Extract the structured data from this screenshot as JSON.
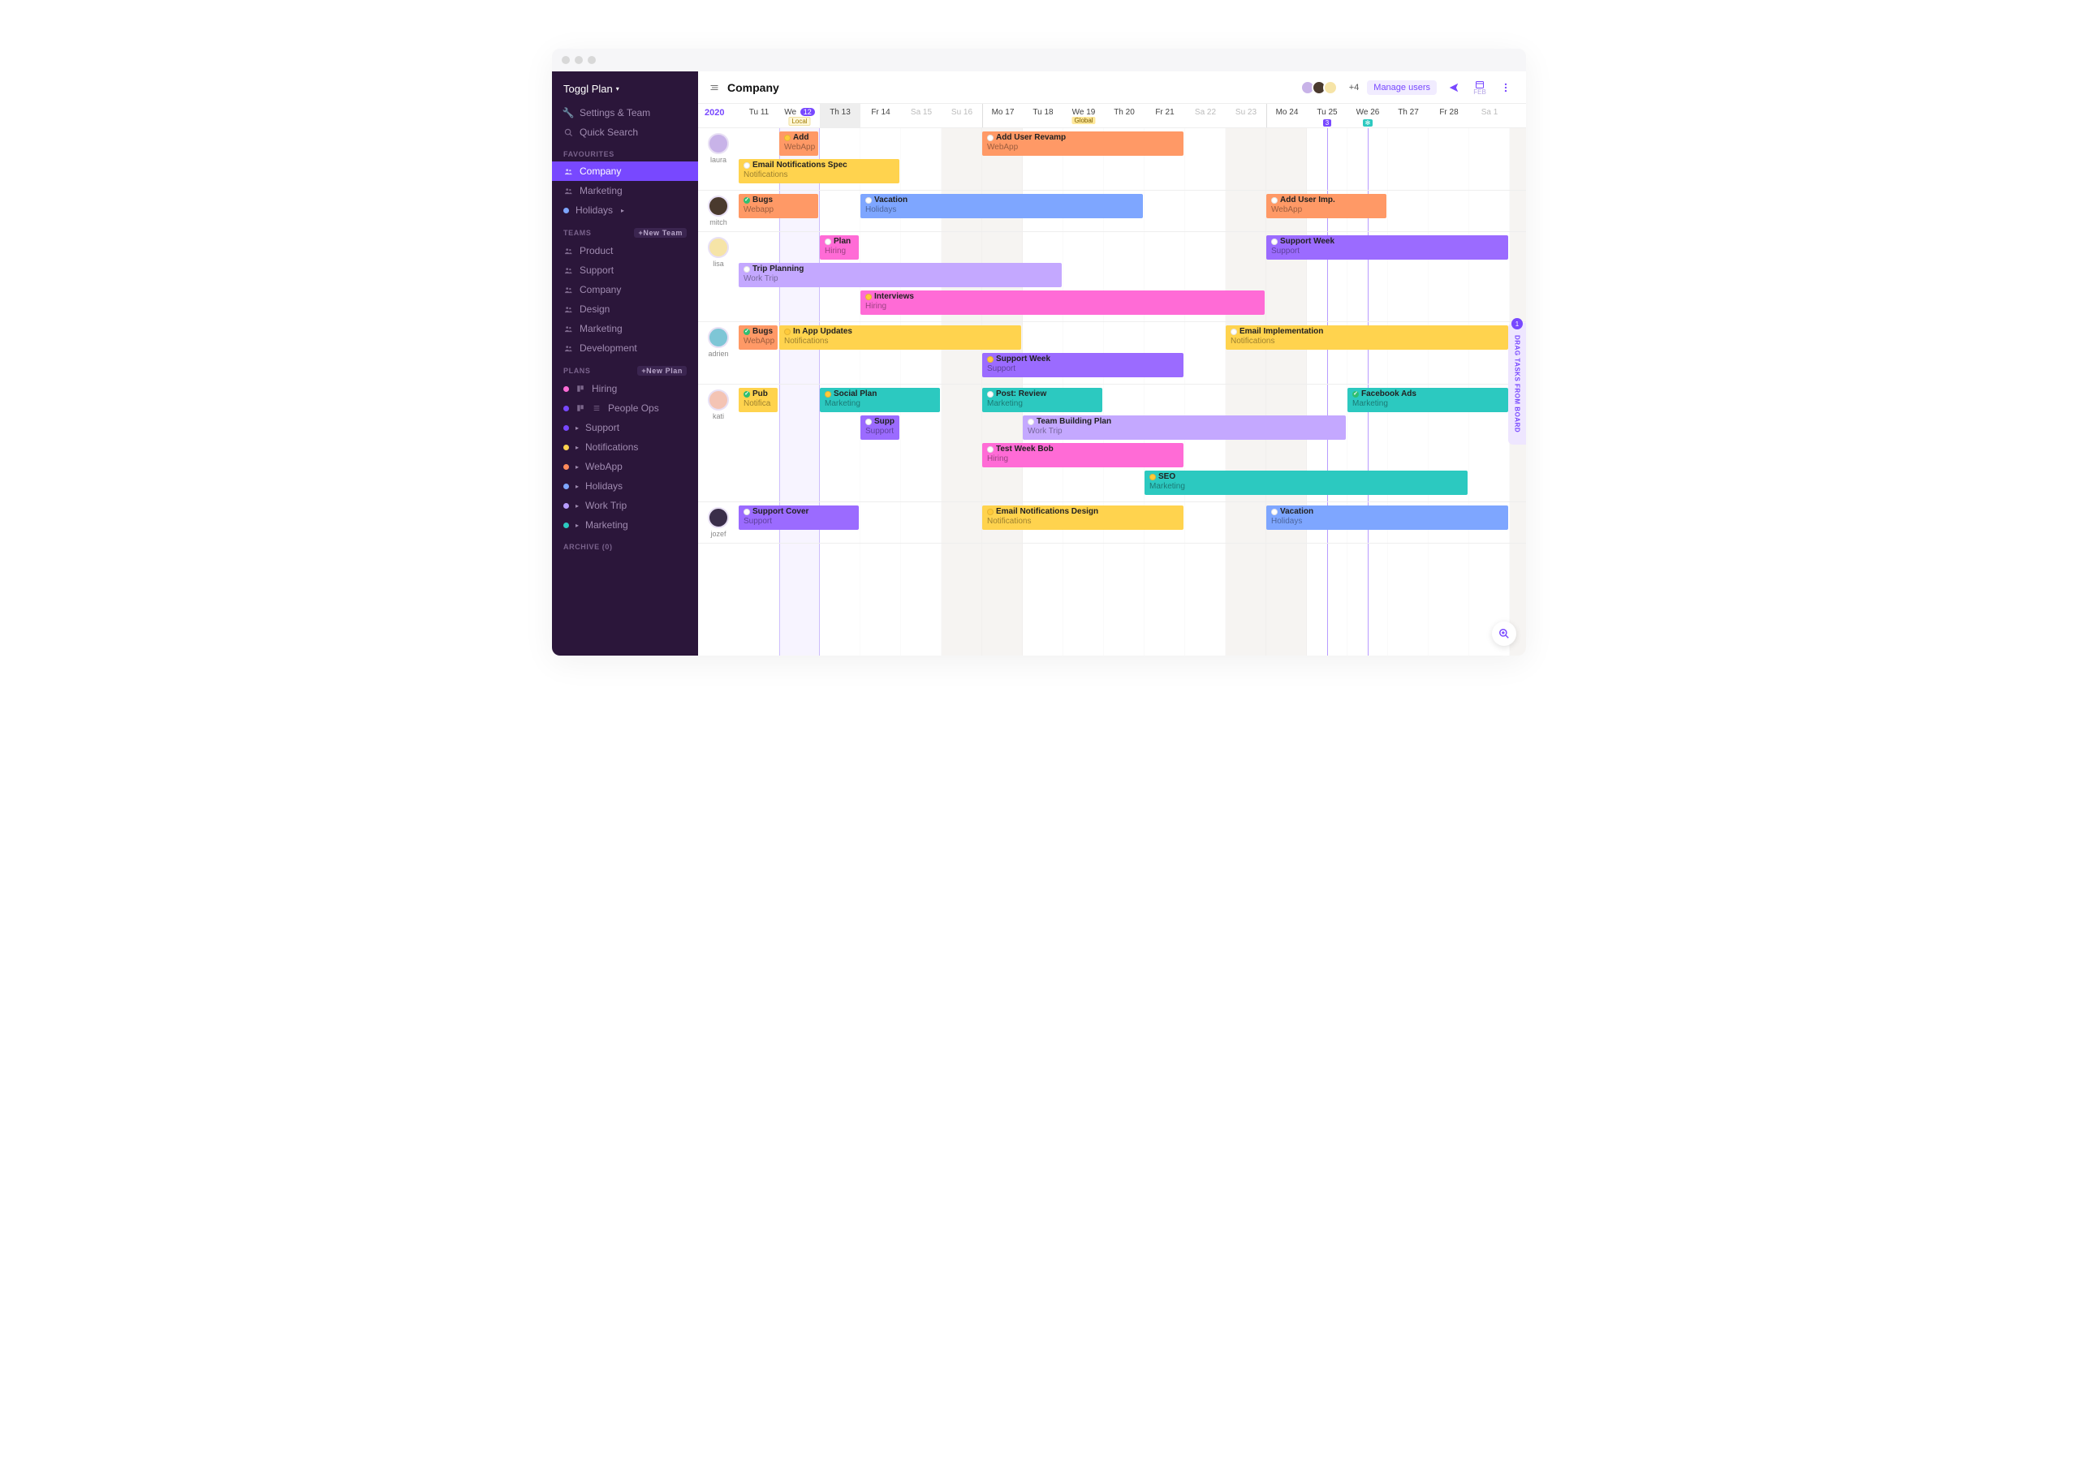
{
  "brand": "Toggl Plan",
  "sidebar": {
    "settings": "Settings & Team",
    "search": "Quick Search",
    "favourites_head": "FAVOURITES",
    "favourites": [
      {
        "label": "Company",
        "type": "team",
        "active": true
      },
      {
        "label": "Marketing",
        "type": "team"
      },
      {
        "label": "Holidays",
        "type": "plan",
        "color": "#7ea6ff",
        "arrow": true
      }
    ],
    "teams_head": "TEAMS",
    "teams_btn": "+New Team",
    "teams": [
      "Product",
      "Support",
      "Company",
      "Design",
      "Marketing",
      "Development"
    ],
    "plans_head": "PLANS",
    "plans_btn": "+New Plan",
    "plans": [
      {
        "label": "Hiring",
        "color": "#ff6bd6",
        "board": true
      },
      {
        "label": "People Ops",
        "color": "#7848ff",
        "board": true,
        "list": true
      },
      {
        "label": "Support",
        "color": "#7848ff",
        "arrow": true
      },
      {
        "label": "Notifications",
        "color": "#ffd34e",
        "arrow": true
      },
      {
        "label": "WebApp",
        "color": "#ff8a5b",
        "arrow": true
      },
      {
        "label": "Holidays",
        "color": "#7ea6ff",
        "arrow": true
      },
      {
        "label": "Work Trip",
        "color": "#b89cff",
        "arrow": true
      },
      {
        "label": "Marketing",
        "color": "#2cc9c0",
        "arrow": true
      }
    ],
    "archive": "ARCHIVE (0)"
  },
  "header": {
    "title": "Company",
    "user_count": "+4",
    "manage": "Manage users",
    "feb": "FEB"
  },
  "dates": {
    "year": "2020",
    "days": [
      {
        "label": "Tu 11"
      },
      {
        "label": "We",
        "num": "12",
        "today": true,
        "tag": "Local",
        "tagClass": "local"
      },
      {
        "label": "Th 13",
        "hl": true
      },
      {
        "label": "Fr 14"
      },
      {
        "label": "Sa 15",
        "wknd": true
      },
      {
        "label": "Su 16",
        "wknd": true
      },
      {
        "label": "Mo 17",
        "weekstart": true
      },
      {
        "label": "Tu 18"
      },
      {
        "label": "We 19",
        "tag": "Global",
        "tagClass": "global"
      },
      {
        "label": "Th 20"
      },
      {
        "label": "Fr 21"
      },
      {
        "label": "Sa 22",
        "wknd": true
      },
      {
        "label": "Su 23",
        "wknd": true
      },
      {
        "label": "Mo 24",
        "weekstart": true
      },
      {
        "label": "Tu 25",
        "marker": "3",
        "markerColor": "#7848ff"
      },
      {
        "label": "We 26",
        "marker": "✻",
        "markerColor": "#2cc9c0"
      },
      {
        "label": "Th 27"
      },
      {
        "label": "Fr 28"
      },
      {
        "label": "Sa 1",
        "wknd": true
      }
    ]
  },
  "people": [
    {
      "name": "laura",
      "color": "#c8b3e8",
      "lanes": [
        [
          {
            "start": 1,
            "span": 1,
            "color": "#ff9966",
            "title": "Add",
            "sub": "WebApp",
            "status": "#ffca3a"
          },
          {
            "start": 6,
            "span": 5,
            "color": "#ff9966",
            "title": "Add User Revamp",
            "sub": "WebApp",
            "status": "#ffffff"
          }
        ],
        [
          {
            "start": 0,
            "span": 4,
            "color": "#ffd34e",
            "title": "Email Notifications Spec",
            "sub": "Notifications",
            "status": "#ffffff"
          }
        ]
      ]
    },
    {
      "name": "mitch",
      "color": "#4a3a2e",
      "lanes": [
        [
          {
            "start": 0,
            "span": 2,
            "color": "#ff9966",
            "title": "Bugs",
            "sub": "Webapp",
            "status": "#2fbf71",
            "check": true
          },
          {
            "start": 3,
            "span": 7,
            "color": "#7ea6ff",
            "title": "Vacation",
            "sub": "Holidays",
            "status": "#ffffff"
          },
          {
            "start": 13,
            "span": 3,
            "color": "#ff9966",
            "title": "Add User Imp.",
            "sub": "WebApp",
            "status": "#ffffff"
          }
        ]
      ]
    },
    {
      "name": "lisa",
      "color": "#f6e4a7",
      "lanes": [
        [
          {
            "start": 2,
            "span": 1,
            "color": "#ff6bd6",
            "title": "Plan",
            "sub": "Hiring",
            "status": "#ffffff"
          },
          {
            "start": 13,
            "span": 6,
            "color": "#9b6bff",
            "title": "Support Week",
            "sub": "Support",
            "status": "#ffffff"
          }
        ],
        [
          {
            "start": 0,
            "span": 8,
            "color": "#c4a8ff",
            "title": "Trip Planning",
            "sub": "Work Trip",
            "status": "#ffffff"
          }
        ],
        [
          {
            "start": 3,
            "span": 10,
            "color": "#ff6bd6",
            "title": "Interviews",
            "sub": "Hiring",
            "status": "#ffca3a"
          }
        ]
      ]
    },
    {
      "name": "adrien",
      "color": "#7ec6d6",
      "lanes": [
        [
          {
            "start": 0,
            "span": 1,
            "color": "#ff9966",
            "title": "Bugs",
            "sub": "WebApp",
            "status": "#2fbf71",
            "check": true
          },
          {
            "start": 1,
            "span": 6,
            "color": "#ffd34e",
            "title": "In App Updates",
            "sub": "Notifications",
            "status": "#ffca3a"
          },
          {
            "start": 12,
            "span": 7,
            "color": "#ffd34e",
            "title": "Email Implementation",
            "sub": "Notifications",
            "status": "#ffffff"
          }
        ],
        [
          {
            "start": 6,
            "span": 5,
            "color": "#9b6bff",
            "title": "Support Week",
            "sub": "Support",
            "status": "#ffca3a"
          }
        ]
      ]
    },
    {
      "name": "kati",
      "color": "#f4c4b4",
      "lanes": [
        [
          {
            "start": 0,
            "span": 1,
            "color": "#ffd34e",
            "title": "Pub",
            "sub": "Notifica",
            "status": "#2fbf71",
            "check": true
          },
          {
            "start": 2,
            "span": 3,
            "color": "#2cc9c0",
            "title": "Social Plan",
            "sub": "Marketing",
            "status": "#ffca3a"
          },
          {
            "start": 6,
            "span": 3,
            "color": "#2cc9c0",
            "title": "Post: Review",
            "sub": "Marketing",
            "status": "#ffffff"
          },
          {
            "start": 15,
            "span": 4,
            "color": "#2cc9c0",
            "title": "Facebook Ads",
            "sub": "Marketing",
            "status": "#2fbf71",
            "check": true
          }
        ],
        [
          {
            "start": 3,
            "span": 1,
            "color": "#9b6bff",
            "title": "Supp",
            "sub": "Support",
            "status": "#ffffff"
          },
          {
            "start": 7,
            "span": 8,
            "color": "#c4a8ff",
            "title": "Team Building Plan",
            "sub": "Work Trip",
            "status": "#ffffff"
          }
        ],
        [
          {
            "start": 6,
            "span": 5,
            "color": "#ff6bd6",
            "title": "Test Week Bob",
            "sub": "Hiring",
            "status": "#ffffff"
          }
        ],
        [
          {
            "start": 10,
            "span": 8,
            "color": "#2cc9c0",
            "title": "SEO",
            "sub": "Marketing",
            "status": "#ffca3a"
          }
        ]
      ]
    },
    {
      "name": "jozef",
      "color": "#3a2e4a",
      "lanes": [
        [
          {
            "start": 0,
            "span": 3,
            "color": "#9b6bff",
            "title": "Support Cover",
            "sub": "Support",
            "status": "#ffffff"
          },
          {
            "start": 6,
            "span": 5,
            "color": "#ffd34e",
            "title": "Email Notifications Design",
            "sub": "Notifications",
            "status": "#ffca3a"
          },
          {
            "start": 13,
            "span": 6,
            "color": "#7ea6ff",
            "title": "Vacation",
            "sub": "Holidays",
            "status": "#ffffff"
          }
        ]
      ]
    }
  ],
  "drag": {
    "label": "DRAG TASKS FROM BOARD",
    "count": "1"
  }
}
